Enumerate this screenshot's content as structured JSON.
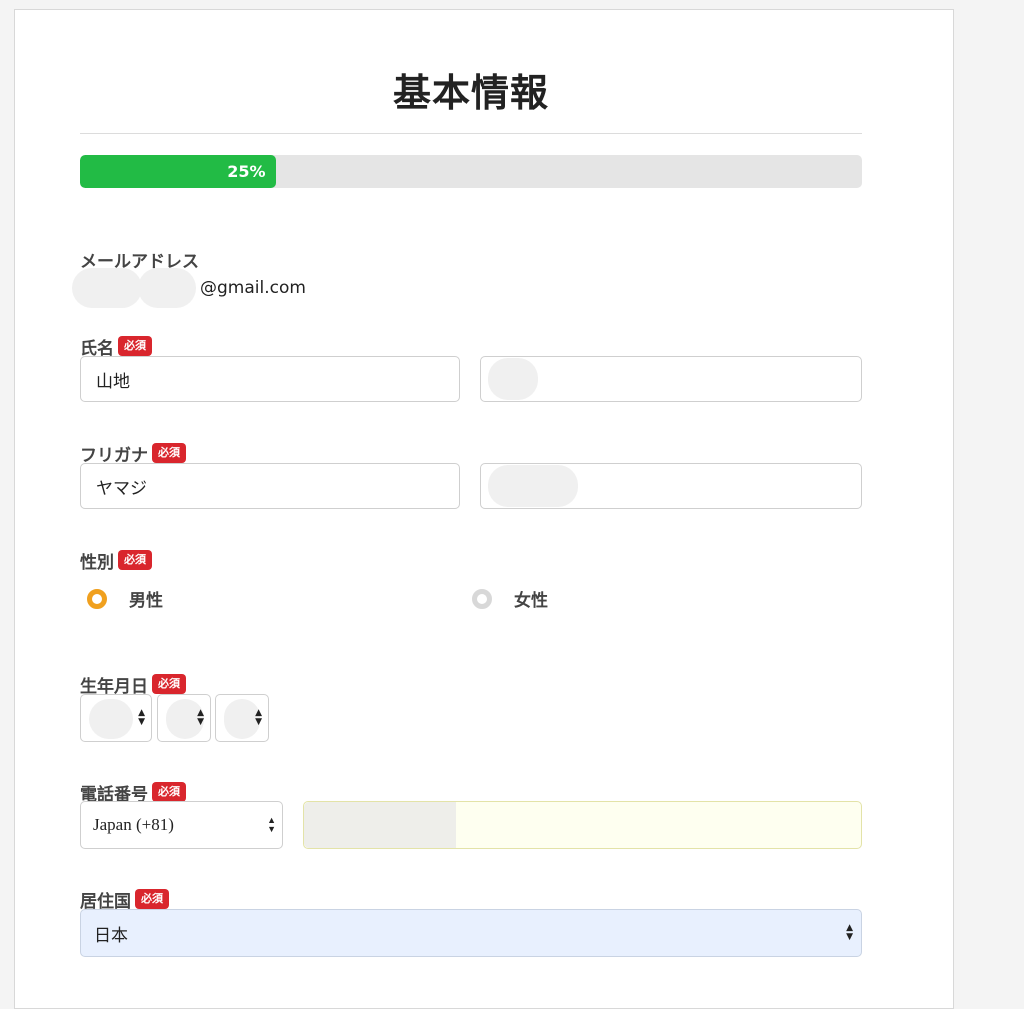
{
  "page": {
    "title": "基本情報"
  },
  "progress": {
    "value": 25,
    "label": "25%"
  },
  "colors": {
    "accent": "#22bb45",
    "required": "#d9262d",
    "radio_selected": "#f0a01e"
  },
  "required_badge": "必須",
  "email": {
    "label": "メールアドレス",
    "domain": "@gmail.com"
  },
  "name": {
    "label": "氏名",
    "last": "山地",
    "first": ""
  },
  "kana": {
    "label": "フリガナ",
    "last": "ヤマジ",
    "first": ""
  },
  "gender": {
    "label": "性別",
    "options": [
      "男性",
      "女性"
    ],
    "selected": "男性"
  },
  "birthdate": {
    "label": "生年月日"
  },
  "phone": {
    "label": "電話番号",
    "country": "Japan (+81)"
  },
  "residence": {
    "label": "居住国",
    "value": "日本"
  }
}
